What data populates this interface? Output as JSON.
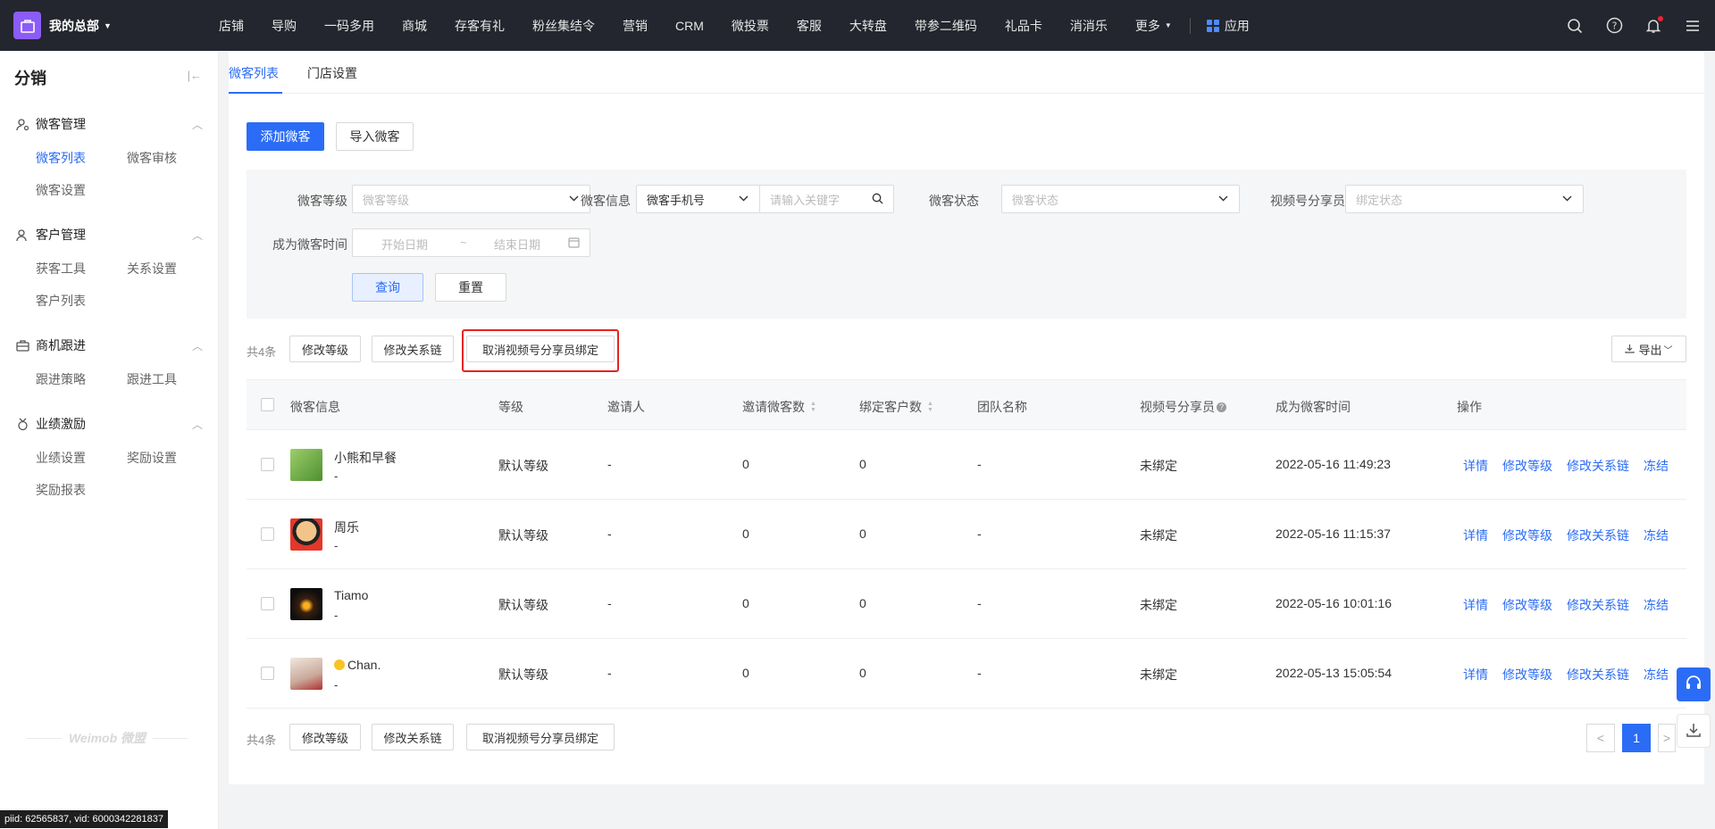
{
  "topbar": {
    "brand": "我的总部",
    "nav": [
      "店铺",
      "导购",
      "一码多用",
      "商城",
      "存客有礼",
      "粉丝集结令",
      "营销",
      "CRM",
      "微投票",
      "客服",
      "大转盘",
      "带参二维码",
      "礼品卡",
      "消消乐",
      "更多"
    ],
    "app_label": "应用",
    "icons": [
      "search-icon",
      "help-icon",
      "bell-icon",
      "menu-icon"
    ]
  },
  "sidebar": {
    "title": "分销",
    "groups": [
      {
        "label": "微客管理",
        "icon": "user-gear-icon",
        "items": [
          "微客列表",
          "微客审核",
          "微客设置"
        ]
      },
      {
        "label": "客户管理",
        "icon": "users-icon",
        "items": [
          "获客工具",
          "关系设置",
          "客户列表"
        ]
      },
      {
        "label": "商机跟进",
        "icon": "briefcase-icon",
        "items": [
          "跟进策略",
          "跟进工具"
        ]
      },
      {
        "label": "业绩激励",
        "icon": "medal-icon",
        "items": [
          "业绩设置",
          "奖励设置",
          "奖励报表"
        ]
      }
    ],
    "watermark": "Weimob 微盟",
    "debug": "piid: 62565837, vid: 6000342281837"
  },
  "tabs": [
    "微客列表",
    "门店设置"
  ],
  "actions": {
    "add": "添加微客",
    "import": "导入微客"
  },
  "filters": {
    "level_label": "微客等级",
    "level_placeholder": "微客等级",
    "info_label": "微客信息",
    "info_select": "微客手机号",
    "info_placeholder": "请输入关键字",
    "status_label": "微客状态",
    "status_placeholder": "微客状态",
    "video_label": "视频号分享员",
    "video_placeholder": "绑定状态",
    "date_label": "成为微客时间",
    "date_start": "开始日期",
    "date_sep": "~",
    "date_end": "结束日期",
    "query": "查询",
    "reset": "重置"
  },
  "bulk": {
    "count": "共4条",
    "modify_level": "修改等级",
    "modify_chain": "修改关系链",
    "unbind": "取消视频号分享员绑定",
    "export": "导出"
  },
  "table": {
    "headers": [
      "微客信息",
      "等级",
      "邀请人",
      "邀请微客数",
      "绑定客户数",
      "团队名称",
      "视频号分享员",
      "成为微客时间",
      "操作"
    ],
    "rows": [
      {
        "name": "小熊和早餐",
        "sub": "-",
        "level": "默认等级",
        "inviter": "-",
        "invites": "0",
        "customers": "0",
        "team": "-",
        "video": "未绑定",
        "time": "2022-05-16 11:49:23",
        "emoji": false
      },
      {
        "name": "周乐",
        "sub": "-",
        "level": "默认等级",
        "inviter": "-",
        "invites": "0",
        "customers": "0",
        "team": "-",
        "video": "未绑定",
        "time": "2022-05-16 11:15:37",
        "emoji": false
      },
      {
        "name": "Tiamo",
        "sub": "-",
        "level": "默认等级",
        "inviter": "-",
        "invites": "0",
        "customers": "0",
        "team": "-",
        "video": "未绑定",
        "time": "2022-05-16 10:01:16",
        "emoji": false
      },
      {
        "name": "Chan.",
        "sub": "-",
        "level": "默认等级",
        "inviter": "-",
        "invites": "0",
        "customers": "0",
        "team": "-",
        "video": "未绑定",
        "time": "2022-05-13 15:05:54",
        "emoji": true
      }
    ],
    "ops": [
      "详情",
      "修改等级",
      "修改关系链",
      "冻结"
    ]
  },
  "pagination": {
    "current": "1",
    "prev": "<",
    "next": ">"
  },
  "colors": {
    "accent": "#2b6cf6",
    "topbar": "#23262e",
    "highlight": "#e62222"
  }
}
